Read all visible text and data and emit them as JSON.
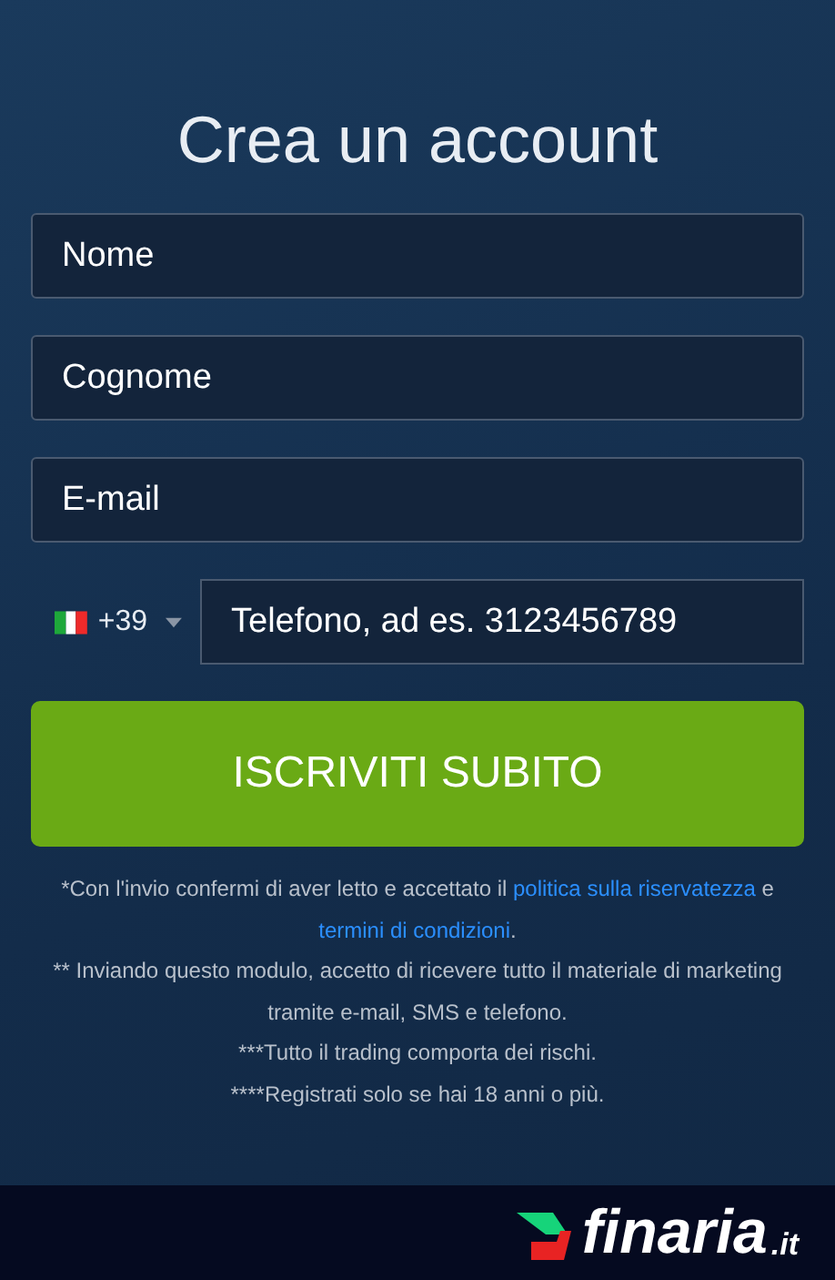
{
  "title": "Crea un account",
  "fields": [
    {
      "placeholder": "Nome"
    },
    {
      "placeholder": "Cognome"
    },
    {
      "placeholder": "E-mail"
    }
  ],
  "phone": {
    "country_code": "+39",
    "placeholder": "Telefono, ad es. 3123456789"
  },
  "submit_button": "ISCRIVITI SUBITO",
  "disclaimer": [
    [
      {
        "kind": "text",
        "text": "*Con l'invio confermi di aver letto e accettato il "
      },
      {
        "kind": "link",
        "text": "politica sulla riservatezza"
      },
      {
        "kind": "text",
        "text": " e "
      },
      {
        "kind": "link",
        "text": "termini di condizioni"
      },
      {
        "kind": "text",
        "text": "."
      }
    ],
    [
      {
        "kind": "text",
        "text": "** Inviando questo modulo, accetto di ricevere tutto il materiale di marketing tramite e-mail, SMS e telefono."
      }
    ],
    [
      {
        "kind": "text",
        "text": "***Tutto il trading comporta dei rischi."
      }
    ],
    [
      {
        "kind": "text",
        "text": "****Registrati solo se hai 18 anni o più."
      }
    ]
  ],
  "logo": {
    "name": "finaria",
    "suffix": ".it"
  }
}
